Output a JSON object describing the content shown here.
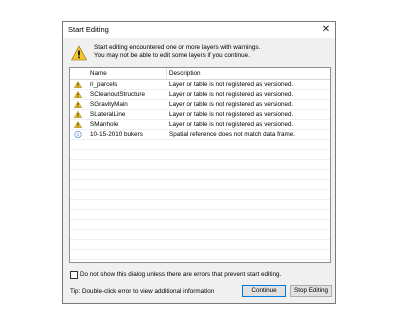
{
  "window": {
    "title": "Start Editing",
    "close_glyph": "✕"
  },
  "message": {
    "line1": "Start editing encountered one or more layers with warnings.",
    "line2": "You may not be able to edit some layers if you continue."
  },
  "table": {
    "columns": [
      "Name",
      "Description"
    ],
    "rows": [
      {
        "icon": "warning-icon",
        "name": "ri_parcels",
        "description": "Layer or table is not registered as versioned."
      },
      {
        "icon": "warning-icon",
        "name": "SCleanoutStructure",
        "description": "Layer or table is not registered as versioned."
      },
      {
        "icon": "warning-icon",
        "name": "SGravityMain",
        "description": "Layer or table is not registered as versioned."
      },
      {
        "icon": "warning-icon",
        "name": "SLateralLine",
        "description": "Layer or table is not registered as versioned."
      },
      {
        "icon": "warning-icon",
        "name": "SManhole",
        "description": "Layer or table is not registered as versioned."
      },
      {
        "icon": "info-icon",
        "name": "10-15-2010 bukers",
        "description": "Spatial reference does not match data frame."
      }
    ]
  },
  "checkbox": {
    "label": "Do not show this dialog unless there are errors that prevent start editing.",
    "checked": false
  },
  "tip": "Tip: Double-click error to view additional information",
  "buttons": {
    "continue": "Continue",
    "stop": "Stop Editing"
  },
  "colors": {
    "warning": "#f4c430",
    "info": "#3a78c2",
    "default_button_border": "#0078d7"
  }
}
